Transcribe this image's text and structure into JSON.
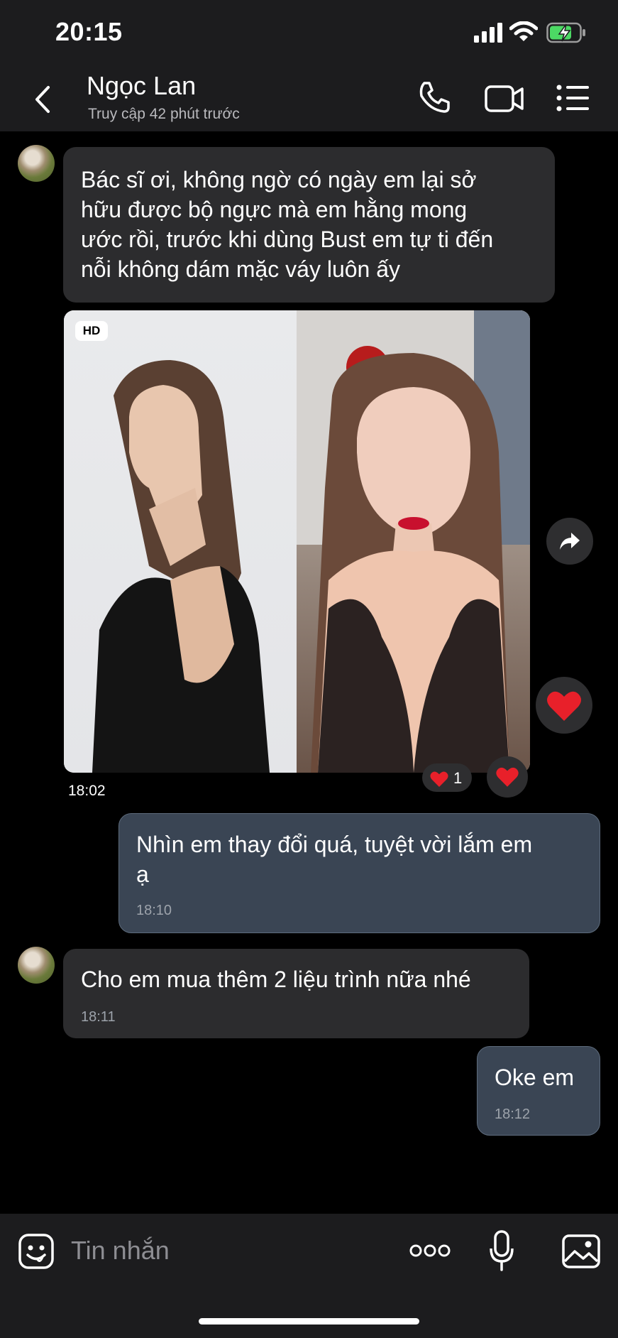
{
  "status_bar": {
    "time": "20:15"
  },
  "header": {
    "contact_name": "Ngọc Lan",
    "contact_status": "Truy cập 42 phút trước"
  },
  "messages": [
    {
      "direction": "incoming",
      "text": "Bác sĩ ơi, không ngờ có ngày em lại sở hữu được bộ ngực mà em hằng mong ước rồi, trước khi dùng Bust em tự ti đến nỗi không dám mặc váy luôn ấy",
      "lines": [
        "Bác sĩ ơi, không ngờ có ngày em lại sở",
        "hữu được bộ ngực mà em hằng mong",
        "ước rồi, trước khi dùng Bust em tự ti đến",
        "nỗi không dám mặc váy luôn ấy"
      ]
    },
    {
      "direction": "incoming",
      "type": "photo",
      "badge": "HD",
      "time": "18:02",
      "reaction_count": "1",
      "reaction_icon": "heart-icon"
    },
    {
      "direction": "outgoing",
      "lines": [
        "Nhìn em thay đổi quá, tuyệt vời lắm em",
        "ạ"
      ],
      "time": "18:10"
    },
    {
      "direction": "incoming",
      "text": "Cho em mua thêm 2 liệu trình nữa nhé",
      "time": "18:11"
    },
    {
      "direction": "outgoing",
      "text": "Oke em",
      "time": "18:12"
    }
  ],
  "input_bar": {
    "placeholder": "Tin nhắn"
  },
  "colors": {
    "background": "#000000",
    "bar": "#1c1c1e",
    "incoming_bubble": "#2c2c2e",
    "outgoing_bubble": "#3a4554",
    "reaction": "#e8202a",
    "battery": "#4cd964"
  }
}
